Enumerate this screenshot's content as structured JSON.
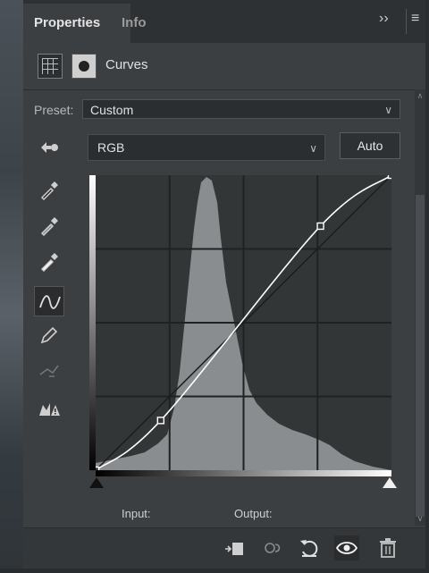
{
  "tabs": {
    "properties": "Properties",
    "info": "Info"
  },
  "header": {
    "title": "Curves"
  },
  "preset": {
    "label": "Preset:",
    "value": "Custom"
  },
  "channel": {
    "value": "RGB"
  },
  "auto_label": "Auto",
  "io": {
    "input_label": "Input:",
    "output_label": "Output:"
  },
  "curve": {
    "points": [
      [
        0,
        0
      ],
      [
        22,
        43
      ],
      [
        76,
        211
      ],
      [
        100,
        255
      ]
    ],
    "input_range": [
      0,
      255
    ],
    "output_range": [
      0,
      255
    ]
  },
  "colors": {
    "panel": "#3c3f42",
    "curve": "#ffffff",
    "histogram": "#8a8d8f"
  }
}
